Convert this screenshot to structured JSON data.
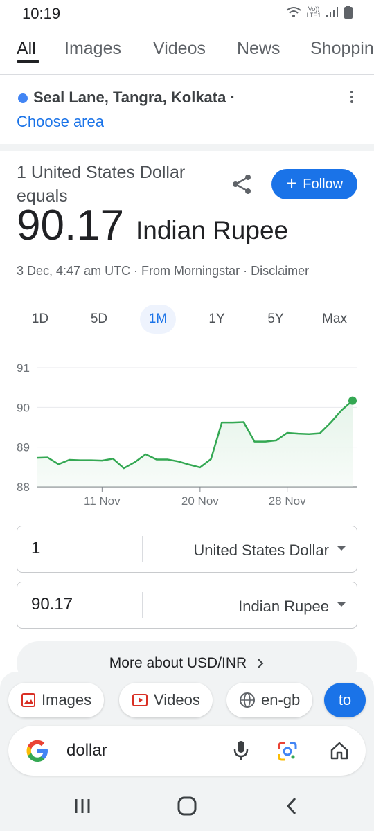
{
  "status": {
    "time": "10:19",
    "network_label": "Vo)) LTE1"
  },
  "tabs": [
    "All",
    "Images",
    "Videos",
    "News",
    "Shopping"
  ],
  "location": {
    "text": "Seal Lane, Tangra, Kolkata ·",
    "choose": "Choose area"
  },
  "rate": {
    "equals": "1 United States Dollar equals",
    "value": "90.17",
    "currency": "Indian Rupee",
    "meta": "3 Dec, 4:47 am UTC · From Morningstar · Disclaimer",
    "follow": "Follow"
  },
  "ranges": [
    "1D",
    "5D",
    "1M",
    "1Y",
    "5Y",
    "Max"
  ],
  "active_range": "1M",
  "chart_data": {
    "type": "area",
    "y_ticks": [
      "91",
      "90",
      "89",
      "88"
    ],
    "ylim": [
      88,
      91
    ],
    "x_ticks": [
      "11 Nov",
      "20 Nov",
      "28 Nov"
    ],
    "x_tick_index": [
      6,
      15,
      23
    ],
    "values": [
      88.73,
      88.74,
      88.57,
      88.68,
      88.67,
      88.67,
      88.66,
      88.71,
      88.47,
      88.62,
      88.82,
      88.69,
      88.69,
      88.64,
      88.56,
      88.49,
      88.7,
      89.62,
      89.62,
      89.63,
      89.14,
      89.14,
      89.17,
      89.36,
      89.34,
      89.33,
      89.35,
      89.62,
      89.93,
      90.17
    ],
    "line_color": "#34a853",
    "fill_color": "#e6f4ea"
  },
  "converter": [
    {
      "amount": "1",
      "currency": "United States Dollar"
    },
    {
      "amount": "90.17",
      "currency": "Indian Rupee"
    }
  ],
  "more": "More about USD/INR",
  "chips": [
    "Images",
    "Videos",
    "en-gb",
    "to"
  ],
  "search": {
    "query": "dollar"
  }
}
